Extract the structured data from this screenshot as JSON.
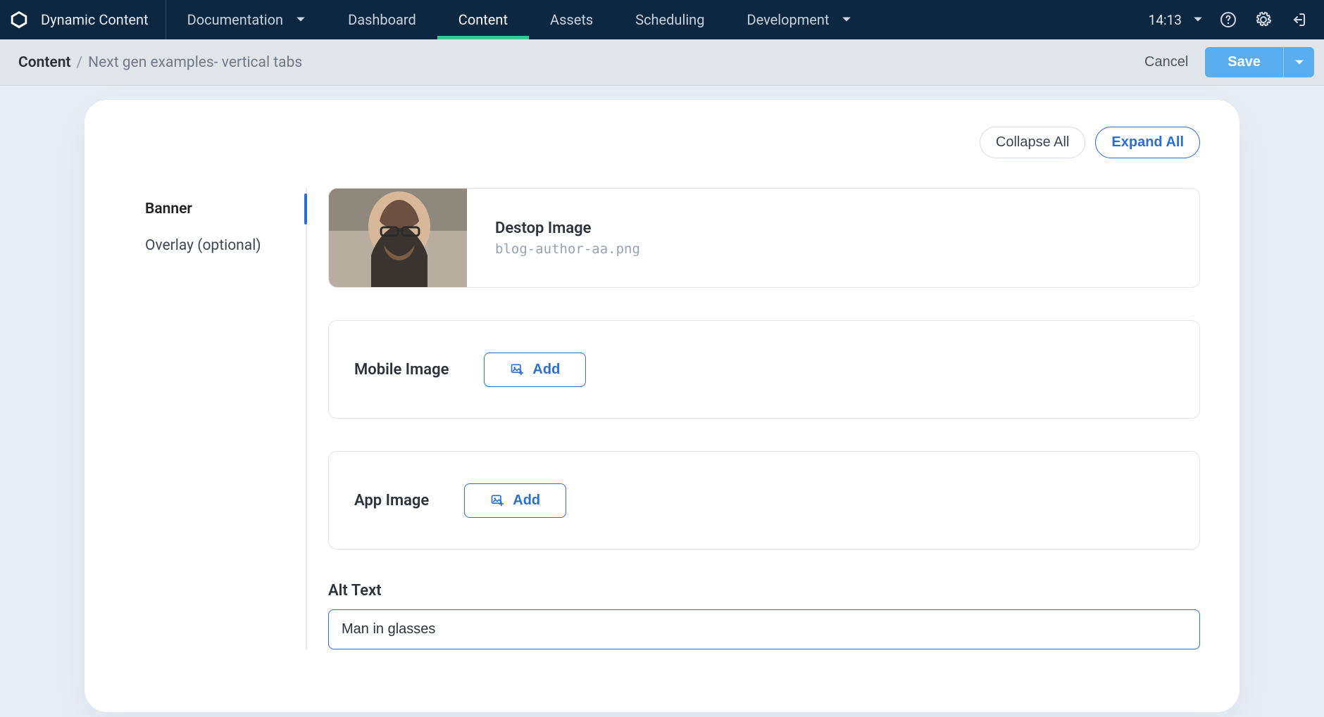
{
  "brand": {
    "title": "Dynamic Content"
  },
  "nav": {
    "documentation": "Documentation",
    "dashboard": "Dashboard",
    "content": "Content",
    "assets": "Assets",
    "scheduling": "Scheduling",
    "development": "Development",
    "time": "14:13"
  },
  "subbar": {
    "breadcrumb_root": "Content",
    "breadcrumb_sep": "/",
    "breadcrumb_page": "Next gen examples- vertical tabs",
    "cancel": "Cancel",
    "save": "Save"
  },
  "controls": {
    "collapse_all": "Collapse All",
    "expand_all": "Expand All"
  },
  "vtabs": {
    "banner": "Banner",
    "overlay": "Overlay (optional)"
  },
  "desktop_image": {
    "label": "Destop Image",
    "filename": "blog-author-aa.png"
  },
  "mobile_image": {
    "label": "Mobile Image",
    "add": "Add"
  },
  "app_image": {
    "label": "App Image",
    "add": "Add"
  },
  "alt_text": {
    "label": "Alt Text",
    "value": "Man in glasses"
  }
}
